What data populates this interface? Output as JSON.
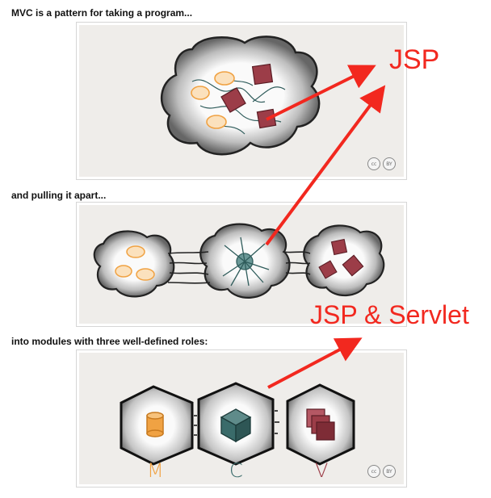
{
  "captions": {
    "first": "MVC is a pattern for taking a program...",
    "second": "and pulling it apart...",
    "third": "into modules with three well-defined roles:"
  },
  "annotations": {
    "jsp": "JSP",
    "jsp_servlet": "JSP & Servlet"
  },
  "mvc_letters": {
    "m": "M",
    "c": "C",
    "v": "V"
  },
  "license_badges": [
    "cc",
    "BY"
  ],
  "colors": {
    "annotation_red": "#f2281f",
    "model_orange": "#f0a243",
    "controller_teal": "#3a6b6a",
    "view_maroon": "#9c3d48",
    "panel_bg": "#efedea"
  }
}
